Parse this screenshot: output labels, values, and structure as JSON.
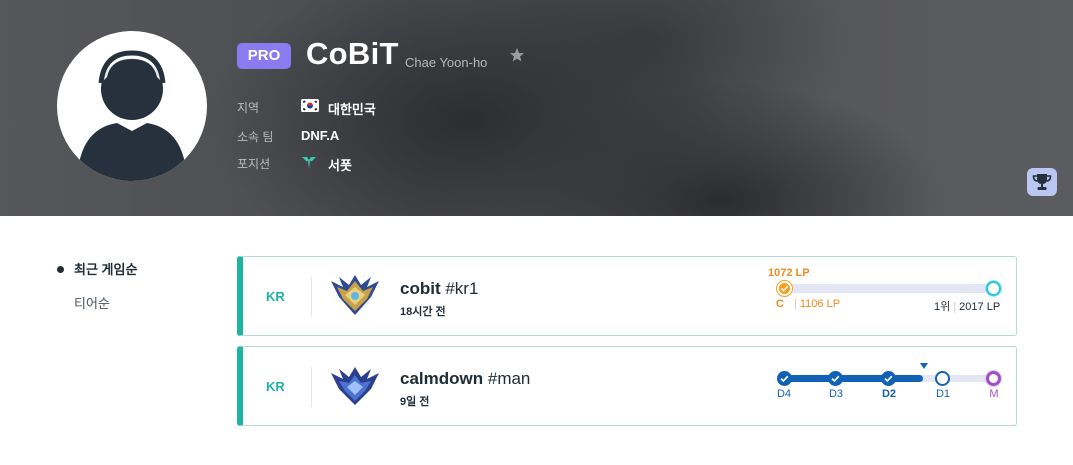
{
  "profile": {
    "badge": "PRO",
    "name": "CoBiT",
    "real_name": "Chae Yoon-ho",
    "fields": [
      {
        "label": "지역",
        "value": "대한민국",
        "icon": "korea-flag-icon"
      },
      {
        "label": "소속 팀",
        "value": "DNF.A"
      },
      {
        "label": "포지션",
        "value": "서폿",
        "icon": "support-position-icon"
      }
    ]
  },
  "sidebar": {
    "items": [
      {
        "label": "최근 게임순",
        "active": true
      },
      {
        "label": "티어순",
        "active": false
      }
    ]
  },
  "accounts": [
    {
      "server": "KR",
      "name": "cobit",
      "tag": "#kr1",
      "time": "18시간 전",
      "emblem": "challenger-emblem-icon",
      "progress": {
        "current_lp": "1072 LP",
        "cutoff_tier": "C",
        "cutoff_lp": "1106 LP",
        "rank": "1위",
        "rank_lp": "2017 LP"
      }
    },
    {
      "server": "KR",
      "name": "calmdown",
      "tag": "#man",
      "time": "9일 전",
      "emblem": "diamond-emblem-icon",
      "progress": {
        "divisions": [
          "D4",
          "D3",
          "D2",
          "D1",
          "M"
        ],
        "current": "D2"
      }
    }
  ],
  "colors": {
    "pro_badge": "#8c7bf0",
    "accent_teal": "#1fb3a2",
    "challenger_orange": "#f08a1c",
    "diamond_blue": "#1161b7",
    "master_purple": "#a24ec7"
  }
}
